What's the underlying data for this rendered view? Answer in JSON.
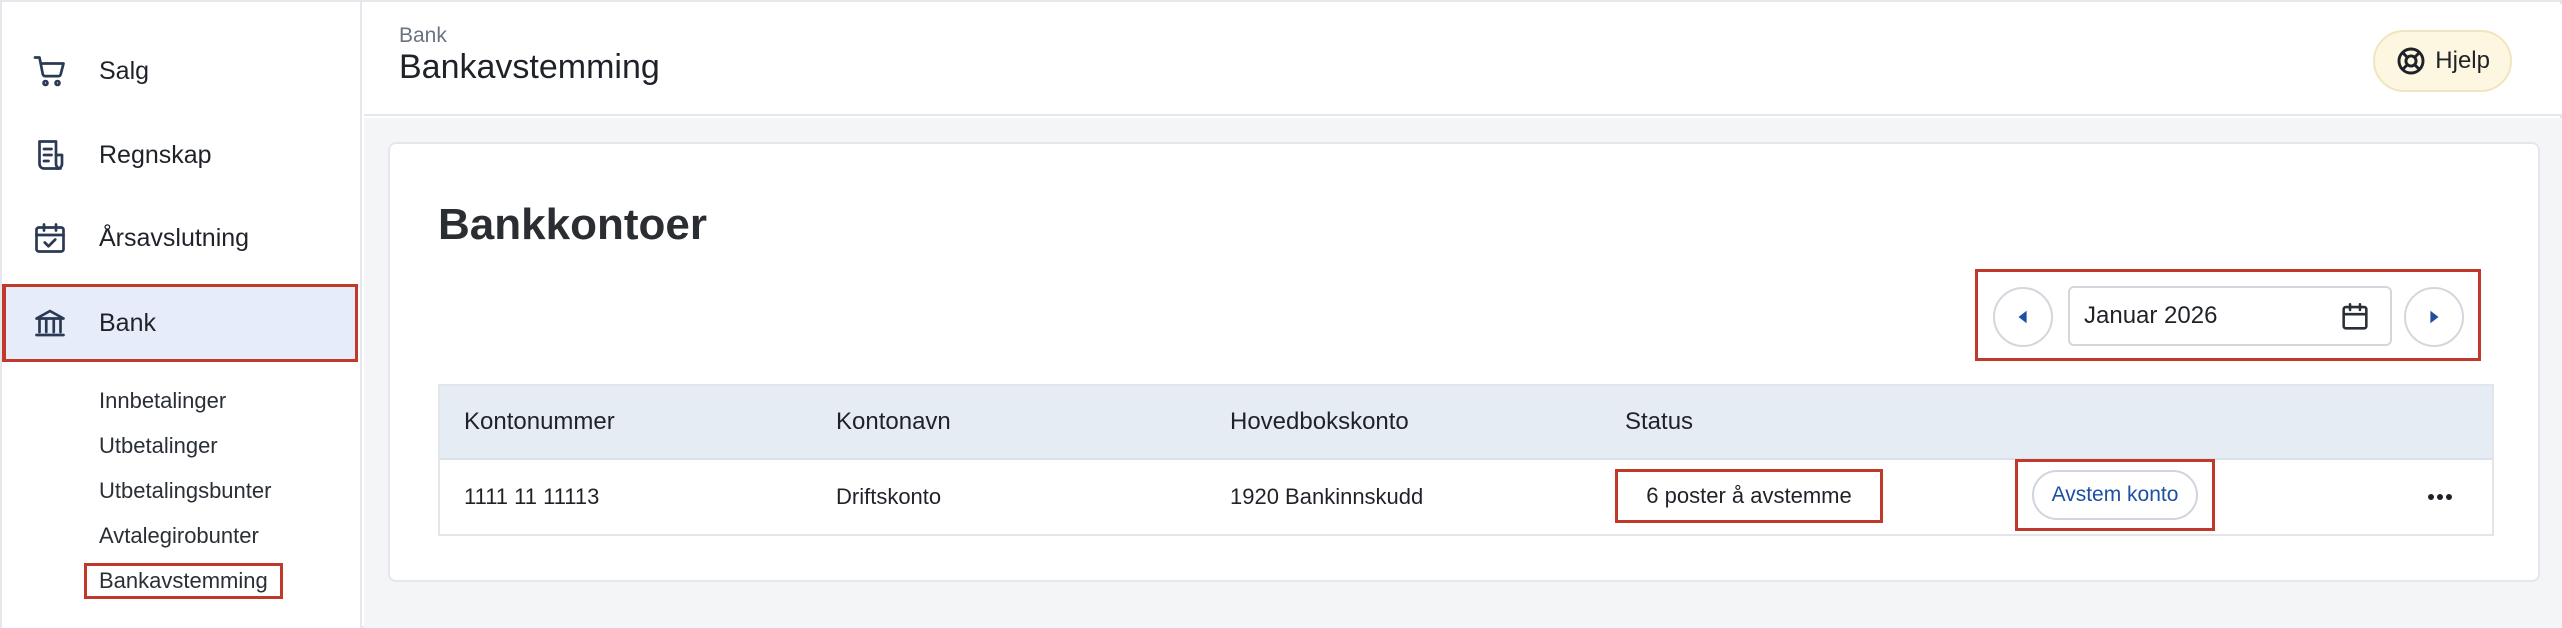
{
  "sidebar": {
    "items": [
      {
        "label": "Salg",
        "icon": "cart-icon"
      },
      {
        "label": "Regnskap",
        "icon": "ledger-icon"
      },
      {
        "label": "Årsavslutning",
        "icon": "calendar-check-icon"
      },
      {
        "label": "Bank",
        "icon": "bank-icon",
        "active": true
      }
    ],
    "bank_subitems": [
      {
        "label": "Innbetalinger"
      },
      {
        "label": "Utbetalinger"
      },
      {
        "label": "Utbetalingsbunter"
      },
      {
        "label": "Avtalegirobunter"
      },
      {
        "label": "Bankavstemming",
        "active": true
      }
    ]
  },
  "header": {
    "breadcrumb": "Bank",
    "title": "Bankavstemming",
    "help_label": "Hjelp",
    "help_icon": "lifebuoy-icon"
  },
  "main": {
    "card_title": "Bankkontoer",
    "date_picker": {
      "value": "Januar 2026",
      "prev_icon": "caret-left-icon",
      "next_icon": "caret-right-icon",
      "calendar_icon": "calendar-icon"
    },
    "table": {
      "columns": [
        "Kontonummer",
        "Kontonavn",
        "Hovedbokskonto",
        "Status"
      ],
      "rows": [
        {
          "kontonummer": "1111 11 11113",
          "kontonavn": "Driftskonto",
          "hovedbokskonto": "1920 Bankinnskudd",
          "status": "6 poster å avstemme",
          "action_label": "Avstem konto",
          "more_icon": "more-horizontal-icon"
        }
      ]
    }
  },
  "colors": {
    "accent_blue": "#1f4fa3",
    "active_nav_bg": "#e6ecfa",
    "highlight_red": "#c0392b",
    "help_bg": "#fdf6e0",
    "table_header_bg": "#e6ecf3"
  }
}
